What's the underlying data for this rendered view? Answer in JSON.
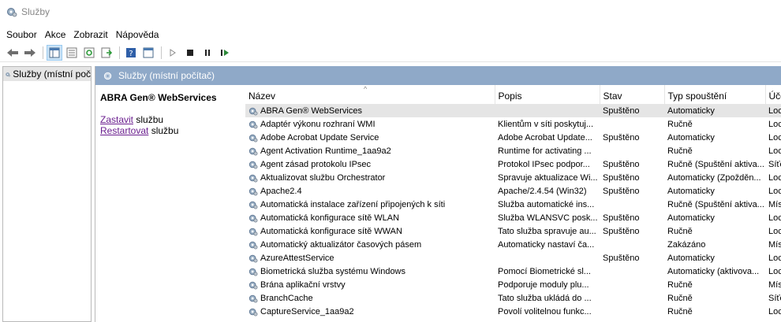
{
  "window": {
    "title": "Služby",
    "icon": "services-gear-icon"
  },
  "menu": [
    "Soubor",
    "Akce",
    "Zobrazit",
    "Nápověda"
  ],
  "toolbar": {
    "icons": [
      "back-arrow-icon",
      "forward-arrow-icon",
      "show-console-tree-icon",
      "properties-icon",
      "refresh-icon",
      "export-list-icon",
      "help-icon",
      "console-view-icon",
      "start-service-icon",
      "stop-service-icon",
      "pause-service-icon",
      "resume-service-icon"
    ]
  },
  "tree": {
    "root_label": "Služby (místní poč"
  },
  "main": {
    "header": "Služby (místní počítač)",
    "selected_service": "ABRA Gen® WebServices",
    "actions": [
      {
        "link": "Zastavit",
        "suffix": " službu"
      },
      {
        "link": "Restartovat",
        "suffix": " službu"
      }
    ]
  },
  "table": {
    "columns": [
      "Název",
      "Popis",
      "Stav",
      "Typ spouštění",
      "Účet"
    ],
    "rows": [
      [
        "ABRA Gen® WebServices",
        "",
        "Spuštěno",
        "Automaticky",
        "Loca"
      ],
      [
        "Adaptér výkonu rozhraní WMI",
        "Klientům v síti poskytuj...",
        "",
        "Ručně",
        "Loca"
      ],
      [
        "Adobe Acrobat Update Service",
        "Adobe Acrobat Update...",
        "Spuštěno",
        "Automaticky",
        "Loca"
      ],
      [
        "Agent Activation Runtime_1aa9a2",
        "Runtime for activating ...",
        "",
        "Ručně",
        "Loca"
      ],
      [
        "Agent zásad protokolu IPsec",
        "Protokol IPsec podpor...",
        "Spuštěno",
        "Ručně (Spuštění aktiva...",
        "Síťov"
      ],
      [
        "Aktualizovat službu Orchestrator",
        "Spravuje aktualizace Wi...",
        "Spuštěno",
        "Automaticky (Zpožděn...",
        "Loca"
      ],
      [
        "Apache2.4",
        "Apache/2.4.54 (Win32)",
        "Spuštěno",
        "Automaticky",
        "Loca"
      ],
      [
        "Automatická instalace zařízení připojených k síti",
        "Služba automatické ins...",
        "",
        "Ručně (Spuštění aktiva...",
        "Míst"
      ],
      [
        "Automatická konfigurace sítě WLAN",
        "Služba WLANSVC posk...",
        "Spuštěno",
        "Automaticky",
        "Loca"
      ],
      [
        "Automatická konfigurace sítě WWAN",
        "Tato služba spravuje au...",
        "Spuštěno",
        "Ručně",
        "Loca"
      ],
      [
        "Automatický aktualizátor časových pásem",
        "Automaticky nastaví ča...",
        "",
        "Zakázáno",
        "Míst"
      ],
      [
        "AzureAttestService",
        "",
        "Spuštěno",
        "Automaticky",
        "Loca"
      ],
      [
        "Biometrická služba systému Windows",
        "Pomocí Biometrické sl...",
        "",
        "Automaticky (aktivova...",
        "Loca"
      ],
      [
        "Brána aplikační vrstvy",
        "Podporuje moduly plu...",
        "",
        "Ručně",
        "Míst"
      ],
      [
        "BranchCache",
        "Tato služba ukládá do ...",
        "",
        "Ručně",
        "Síťov"
      ],
      [
        "CaptureService_1aa9a2",
        "Povolí volitelnou funkc...",
        "",
        "Ručně",
        "Loca"
      ]
    ]
  }
}
